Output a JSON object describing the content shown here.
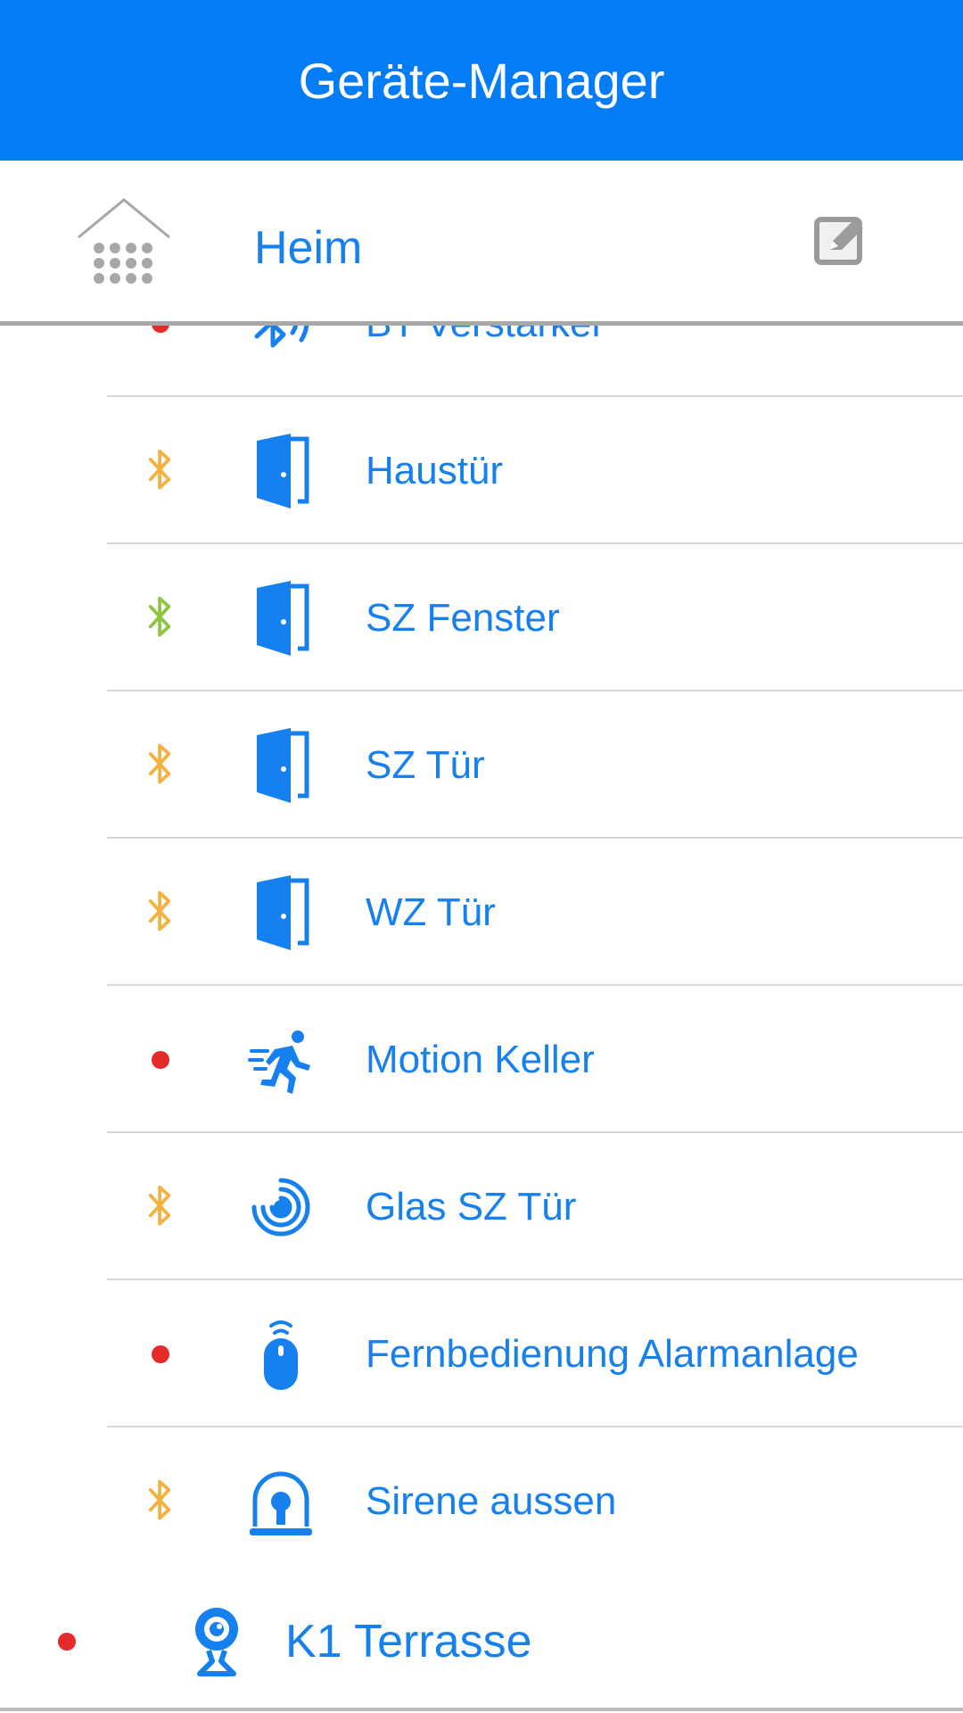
{
  "app": {
    "title": "Geräte-Manager"
  },
  "header": {
    "home_label": "Heim"
  },
  "devices": [
    {
      "label": "BT Verstärker",
      "status": "dot",
      "icon": "bt-repeater-icon"
    },
    {
      "label": "Haustür",
      "status": "bt-orange",
      "icon": "door-icon"
    },
    {
      "label": "SZ Fenster",
      "status": "bt-green",
      "icon": "door-icon"
    },
    {
      "label": "SZ Tür",
      "status": "bt-orange",
      "icon": "door-icon"
    },
    {
      "label": "WZ Tür",
      "status": "bt-orange",
      "icon": "door-icon"
    },
    {
      "label": "Motion Keller",
      "status": "dot",
      "icon": "motion-icon"
    },
    {
      "label": "Glas SZ Tür",
      "status": "bt-orange",
      "icon": "glass-break-icon"
    },
    {
      "label": "Fernbedienung Alarmanlage",
      "status": "dot",
      "icon": "remote-icon"
    },
    {
      "label": "Sirene aussen",
      "status": "bt-orange",
      "icon": "siren-icon"
    }
  ],
  "group": {
    "label": "K1 Terrasse",
    "status": "dot",
    "icon": "camera-icon"
  },
  "colors": {
    "appbar": "#037cf6",
    "accent": "#1680ee",
    "status_offline": "#e52a2a",
    "bt_orange": "#f4b13d",
    "bt_green": "#8cc63f"
  }
}
